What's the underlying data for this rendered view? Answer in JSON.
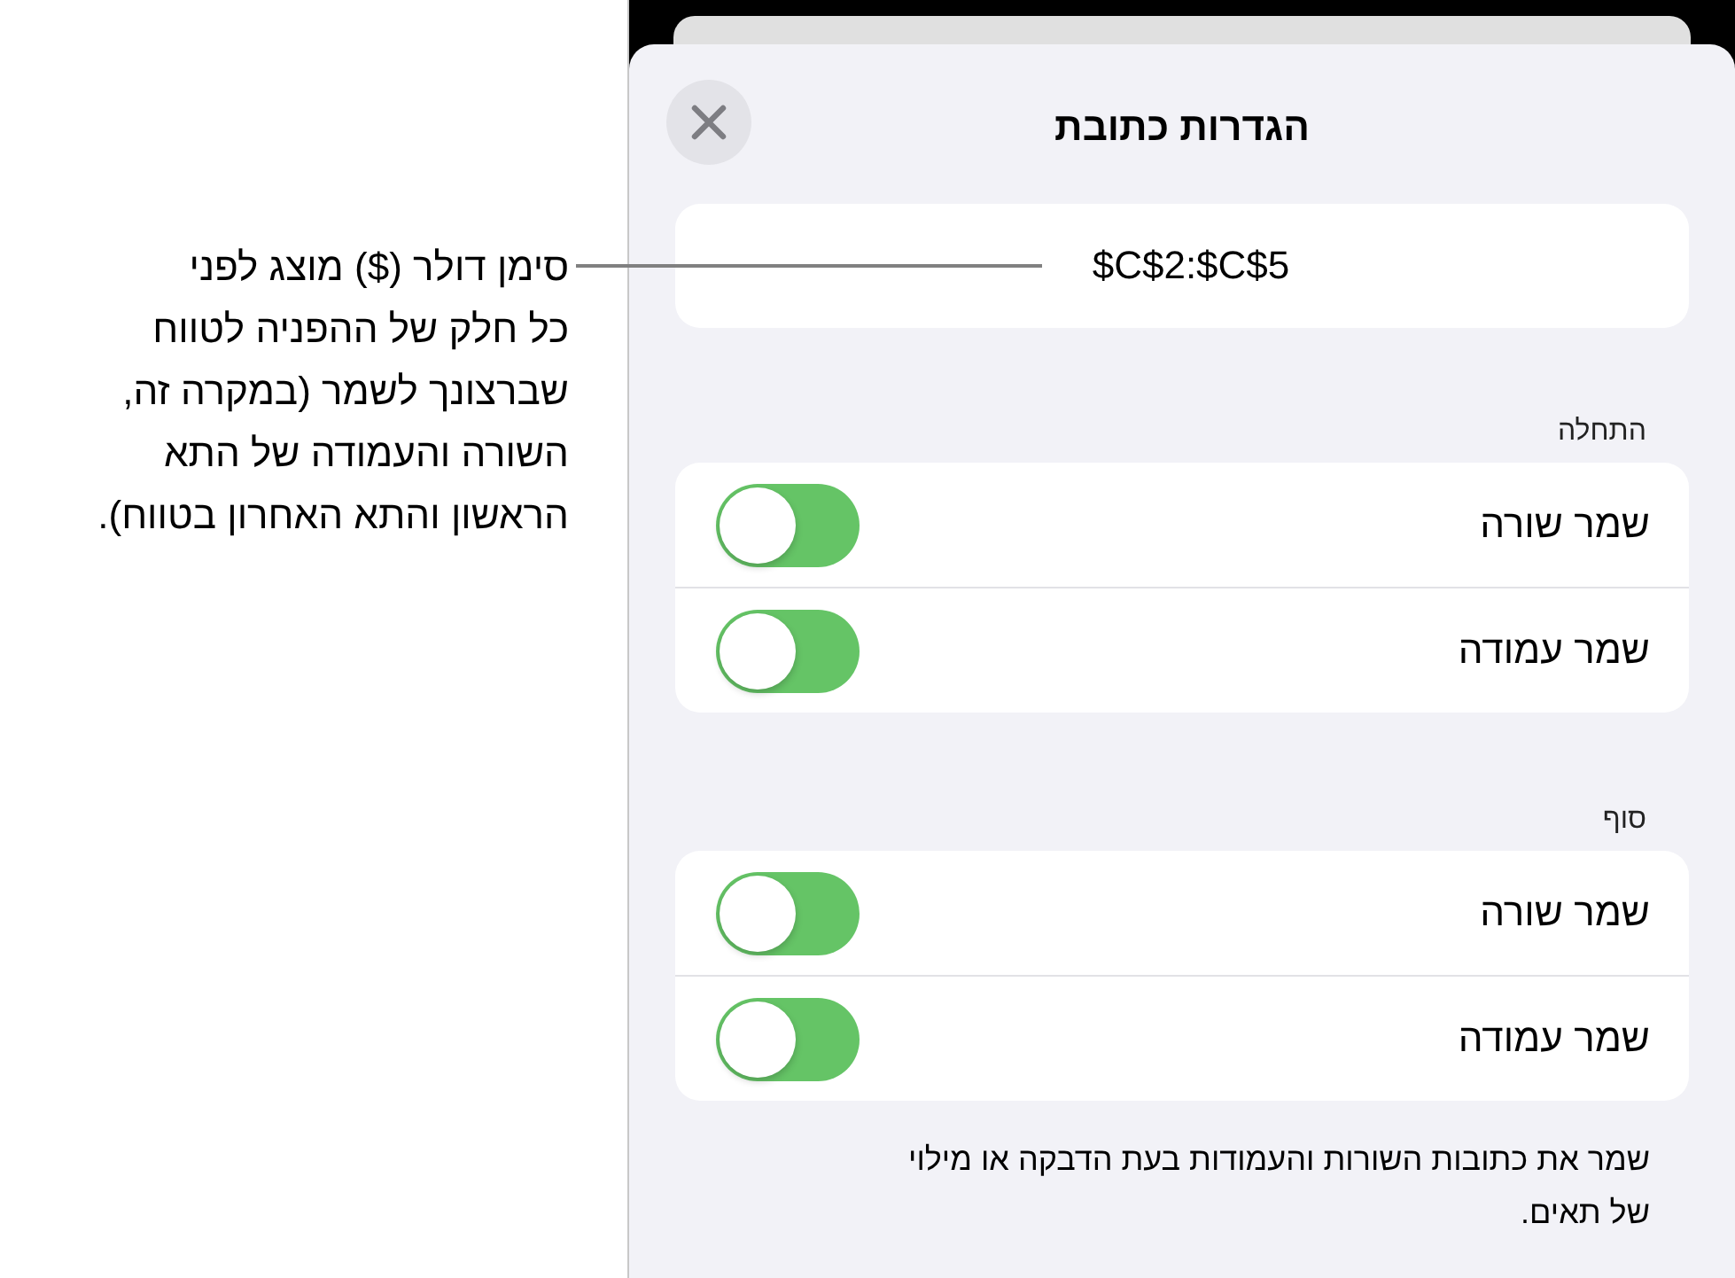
{
  "callout": {
    "lines": [
      "סימן דולר ($) מוצג לפני",
      "כל חלק של ההפניה לטווח",
      "שברצונך לשמר (במקרה זה,",
      "השורה והעמודה של התא",
      "הראשון והתא האחרון בטווח)."
    ]
  },
  "sheet": {
    "title": "הגדרות כתובת",
    "address": "$C$2:$C$5",
    "sections": [
      {
        "label": "התחלה",
        "rows": [
          {
            "label": "שמר שורה",
            "on": true
          },
          {
            "label": "שמר עמודה",
            "on": true
          }
        ]
      },
      {
        "label": "סוף",
        "rows": [
          {
            "label": "שמר שורה",
            "on": true
          },
          {
            "label": "שמר עמודה",
            "on": true
          }
        ]
      }
    ],
    "footnote": [
      "שמר את כתובות השורות והעמודות בעת הדבקה או מילוי",
      "של תאים."
    ]
  }
}
